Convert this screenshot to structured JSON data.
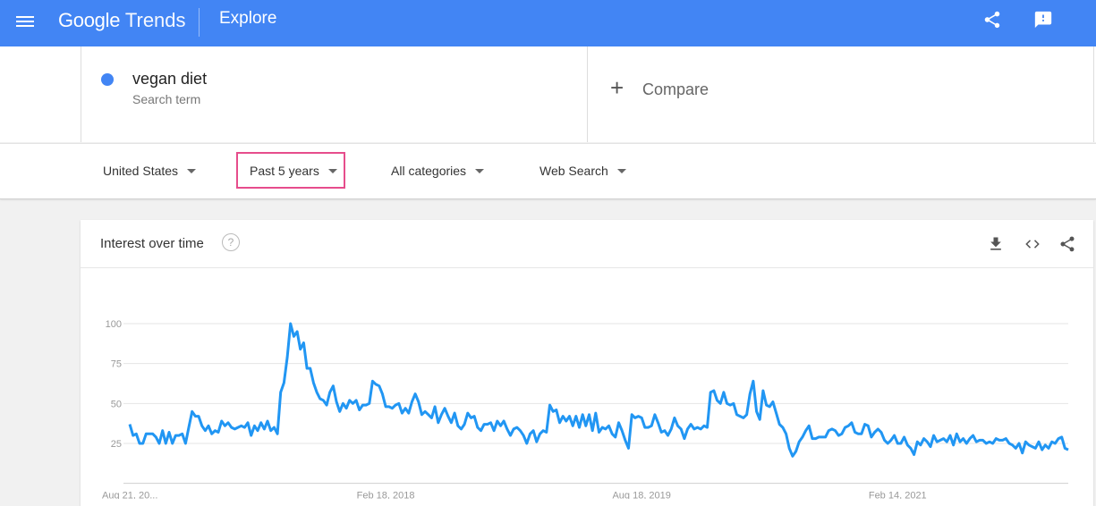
{
  "header": {
    "app_name_brand": "Google",
    "app_name_product": "Trends",
    "page_title": "Explore"
  },
  "search_term": {
    "name": "vegan diet",
    "type": "Search term",
    "color": "#4285f4"
  },
  "compare": {
    "plus": "+",
    "label": "Compare"
  },
  "filters": {
    "region": "United States",
    "time_range": "Past 5 years",
    "category": "All categories",
    "search_type": "Web Search",
    "highlight_color": "#e64d8c"
  },
  "card": {
    "title": "Interest over time",
    "help": "?"
  },
  "colors": {
    "brand": "#4285f4",
    "line": "#2196f3"
  },
  "chart_data": {
    "type": "line",
    "ylim": [
      0,
      100
    ],
    "yticks": [
      25,
      50,
      75,
      100
    ],
    "grid": true,
    "xtick_labels": [
      "Aug 21, 20...",
      "Feb 18, 2018",
      "Aug 18, 2019",
      "Feb 14, 2021"
    ],
    "xtick_weeks": [
      0,
      78,
      156,
      234
    ],
    "series": [
      {
        "values": [
          37,
          30,
          31,
          25,
          25,
          31,
          31,
          31,
          29,
          25,
          33,
          25,
          32,
          25,
          30,
          30,
          31,
          25,
          35,
          45,
          42,
          42,
          36,
          33,
          36,
          31,
          33,
          32,
          39,
          36,
          38,
          35,
          34,
          35,
          36,
          35,
          38,
          30,
          36,
          33,
          38,
          34,
          39,
          33,
          35,
          31,
          57,
          63,
          79,
          100,
          92,
          95,
          84,
          88,
          72,
          72,
          63,
          57,
          53,
          52,
          49,
          57,
          61,
          51,
          45,
          50,
          47,
          52,
          50,
          52,
          46,
          49,
          49,
          50,
          64,
          62,
          61,
          56,
          48,
          48,
          47,
          49,
          50,
          44,
          47,
          44,
          51,
          56,
          51,
          43,
          45,
          43,
          41,
          48,
          38,
          43,
          47,
          42,
          38,
          44,
          36,
          34,
          37,
          44,
          41,
          42,
          35,
          33,
          37,
          37,
          38,
          33,
          39,
          36,
          39,
          34,
          30,
          34,
          35,
          33,
          30,
          25,
          31,
          33,
          26,
          31,
          33,
          32,
          49,
          45,
          46,
          38,
          42,
          39,
          42,
          36,
          42,
          35,
          43,
          36,
          43,
          33,
          44,
          32,
          35,
          34,
          36,
          31,
          29,
          38,
          33,
          27,
          22,
          43,
          41,
          42,
          41,
          35,
          35,
          36,
          43,
          38,
          32,
          33,
          30,
          34,
          41,
          36,
          34,
          28,
          34,
          37,
          34,
          35,
          34,
          36,
          35,
          57,
          58,
          52,
          50,
          57,
          50,
          49,
          50,
          43,
          42,
          41,
          43,
          56,
          64,
          45,
          40,
          58,
          49,
          48,
          51,
          44,
          37,
          35,
          31,
          22,
          17,
          20,
          26,
          29,
          33,
          36,
          28,
          28,
          29,
          29,
          29,
          33,
          34,
          33,
          30,
          31,
          35,
          36,
          38,
          32,
          31,
          31,
          37,
          36,
          29,
          32,
          34,
          32,
          27,
          25,
          27,
          30,
          25,
          25,
          29,
          24,
          22,
          18,
          26,
          24,
          28,
          26,
          23,
          30,
          26,
          27,
          28,
          26,
          30,
          24,
          31,
          26,
          28,
          25,
          28,
          30,
          26,
          27,
          27,
          25,
          26,
          25,
          28,
          27,
          27,
          28,
          25,
          24,
          22,
          25,
          19,
          26,
          24,
          23,
          22,
          26,
          21,
          24,
          22,
          26,
          25,
          28,
          29,
          22,
          21
        ]
      }
    ]
  }
}
